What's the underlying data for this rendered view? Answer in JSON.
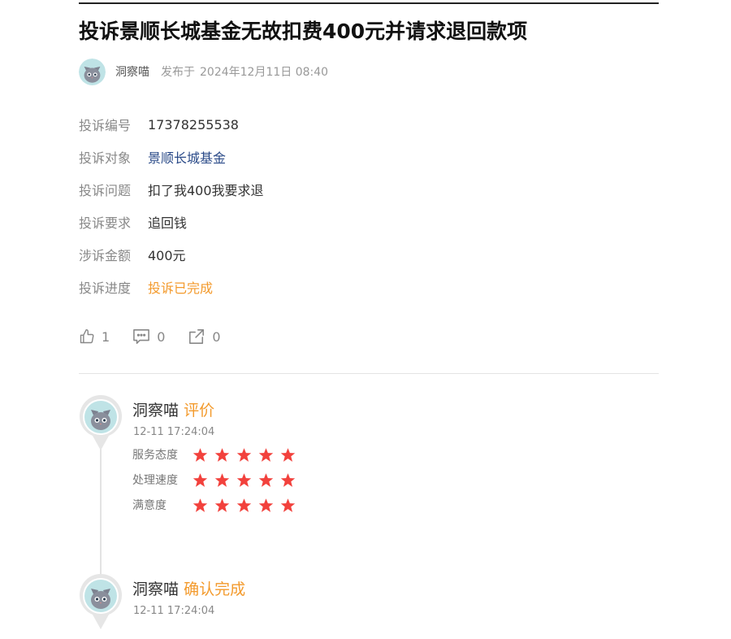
{
  "post": {
    "title": "投诉景顺长城基金无故扣费400元并请求退回款项",
    "author": "洞察喵",
    "publish_label": "发布于",
    "publish_time": "2024年12月11日 08:40"
  },
  "info": [
    {
      "label": "投诉编号",
      "value": "17378255538"
    },
    {
      "label": "投诉对象",
      "value": "景顺长城基金"
    },
    {
      "label": "投诉问题",
      "value": "扣了我400我要求退"
    },
    {
      "label": "投诉要求",
      "value": "追回钱"
    },
    {
      "label": "涉诉金额",
      "value": "400元"
    },
    {
      "label": "投诉进度",
      "value": "投诉已完成"
    }
  ],
  "actions": {
    "likes": "1",
    "comments": "0",
    "shares": "0"
  },
  "timeline": [
    {
      "name": "洞察喵",
      "action": "评价",
      "time": "12-11 17:24:04",
      "ratings": [
        {
          "label": "服务态度",
          "stars": 5
        },
        {
          "label": "处理速度",
          "stars": 5
        },
        {
          "label": "满意度",
          "stars": 5
        }
      ]
    },
    {
      "name": "洞察喵",
      "action": "确认完成",
      "time": "12-11 17:24:04"
    }
  ],
  "colors": {
    "accent_orange": "#f39a2c",
    "link_blue": "#2a4a88",
    "star_red": "#f2413c"
  },
  "icons": [
    "cat-avatar-icon",
    "thumbs-up-icon",
    "comment-icon",
    "share-icon",
    "star-icon"
  ]
}
